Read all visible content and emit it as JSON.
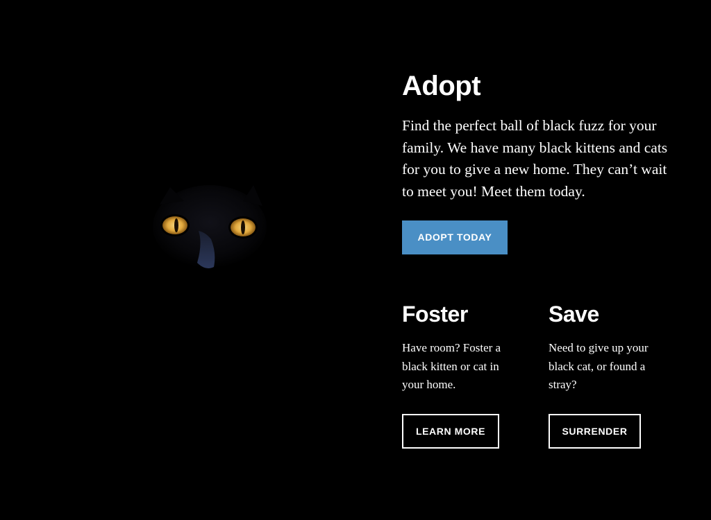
{
  "colors": {
    "background": "#000000",
    "text": "#ffffff",
    "accent": "#4a8fc5",
    "eye": "#e8b84a"
  },
  "image": {
    "subject": "black-cat-with-yellow-eyes"
  },
  "adopt": {
    "title": "Adopt",
    "body": "Find the perfect ball of black fuzz for your family. We have many black kittens and cats for you to give a new home. They can’t wait to meet you! Meet them today.",
    "button_label": "ADOPT TODAY"
  },
  "foster": {
    "title": "Foster",
    "body": "Have room? Foster a black kitten or cat in your home.",
    "button_label": "LEARN MORE"
  },
  "save": {
    "title": "Save",
    "body": "Need to give up your black cat, or found a stray?",
    "button_label": "SURRENDER"
  }
}
